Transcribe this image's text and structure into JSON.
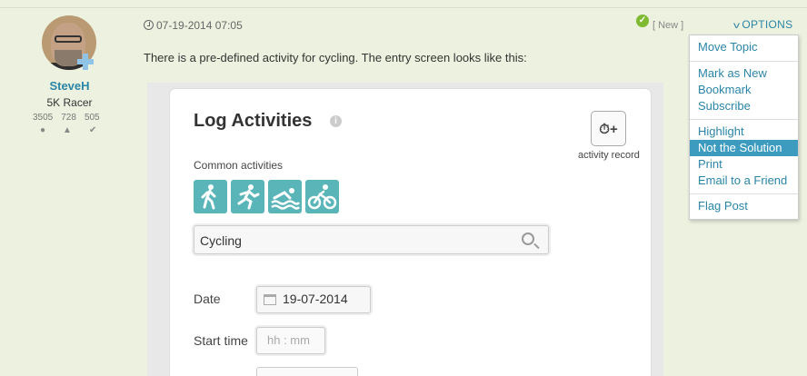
{
  "author": {
    "name": "SteveH",
    "rank": "5K Racer",
    "stats": [
      "3505",
      "728",
      "505"
    ]
  },
  "post": {
    "date": "07-19-2014 07:05",
    "new_tag": "[ New ]",
    "options_label": "OPTIONS",
    "text": "There is a pre-defined activity for cycling. The entry screen looks like this:"
  },
  "screenshot": {
    "title": "Log Activities",
    "record_label": "activity record",
    "common_label": "Common activities",
    "activities": [
      "walking-icon",
      "running-icon",
      "swimming-icon",
      "cycling-icon"
    ],
    "search_value": "Cycling",
    "date_label": "Date",
    "date_value": "19-07-2014",
    "start_label": "Start time",
    "time_placeholder": "hh  : mm"
  },
  "menu": {
    "items": [
      "Move Topic",
      "Mark as New",
      "Bookmark",
      "Subscribe",
      "Highlight",
      "Not the Solution",
      "Print",
      "Email to a Friend",
      "Flag Post"
    ],
    "active": "Not the Solution"
  },
  "colors": {
    "background": "#edf2e0",
    "link": "#2a85a6",
    "highlight": "#3d9bbf",
    "activity_tile": "#5ab5b9"
  }
}
